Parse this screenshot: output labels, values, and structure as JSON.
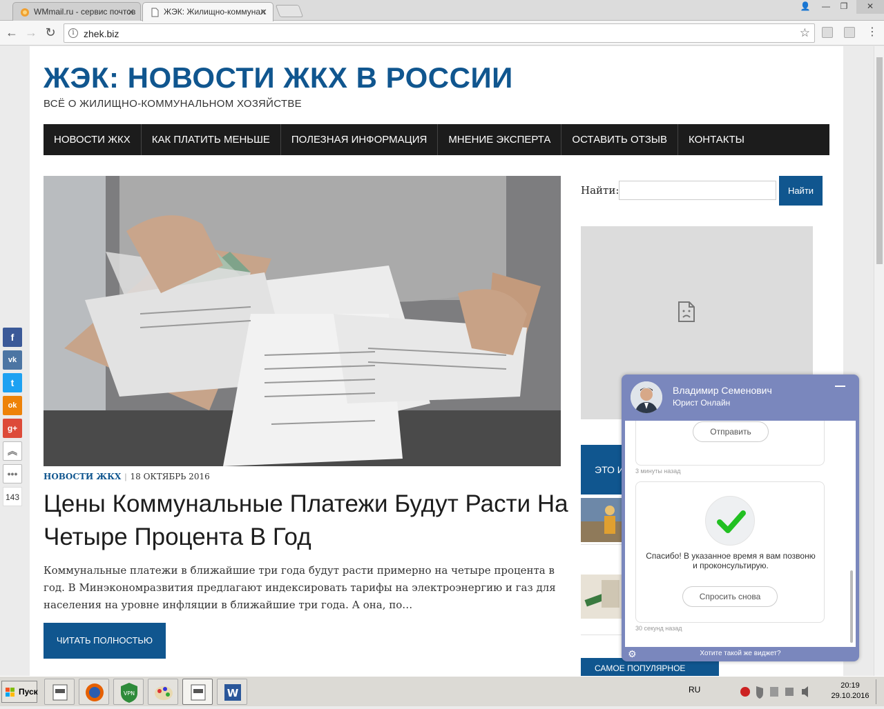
{
  "browser": {
    "tabs": [
      {
        "title": "WMmail.ru - сервис почтов",
        "active": false
      },
      {
        "title": "ЖЭК: Жилищно-коммунал",
        "active": true
      }
    ],
    "url": "zhek.biz"
  },
  "site": {
    "title": "ЖЭК: НОВОСТИ ЖКХ В РОССИИ",
    "description": "ВСЁ О ЖИЛИЩНО-КОММУНАЛЬНОМ ХОЗЯЙСТВЕ"
  },
  "menu": {
    "items": [
      "НОВОСТИ ЖКХ",
      "КАК ПЛАТИТЬ МЕНЬШЕ",
      "ПОЛЕЗНАЯ ИНФОРМАЦИЯ",
      "МНЕНИЕ ЭКСПЕРТА",
      "ОСТАВИТЬ ОТЗЫВ",
      "КОНТАКТЫ"
    ]
  },
  "post": {
    "category": "НОВОСТИ ЖКХ",
    "date": "18 ОКТЯБРЬ 2016",
    "title": "Цены Коммунальные Платежи Будут Расти На Четыре Процента В Год",
    "excerpt": "Коммунальные платежи в ближайшие три года будут расти примерно на четыре процента в год. В Минэкономразвития предлагают индексировать тарифы на электроэнергию и газ для населения на уровне инфляции в ближайшие три года. А она, по…",
    "read_more": "ЧИТАТЬ ПОЛНОСТЬЮ"
  },
  "sidebar": {
    "search_label": "Найти:",
    "search_button": "Найти",
    "banner_text": "ЭТО И",
    "banner2_text": "САМОЕ ПОПУЛЯРНОЕ"
  },
  "social": {
    "buttons": [
      {
        "icon": "facebook-icon",
        "glyph": "f",
        "color": "#3b5998"
      },
      {
        "icon": "vk-icon",
        "glyph": "vk",
        "color": "#4c75a3"
      },
      {
        "icon": "twitter-icon",
        "glyph": "t",
        "color": "#1da1f2"
      },
      {
        "icon": "odnoklassniki-icon",
        "glyph": "ok",
        "color": "#ee8208"
      },
      {
        "icon": "google-plus-icon",
        "glyph": "g+",
        "color": "#dd4b39"
      }
    ],
    "count": "143"
  },
  "chat": {
    "name": "Владимир Семенович",
    "role": "Юрист Онлайн",
    "send_button": "Отправить",
    "time1": "3 минуты назад",
    "thanks": "Спасибо! В указанное время я вам позвоню и проконсультирую.",
    "ask_again": "Спросить снова",
    "time2": "30 секунд назад",
    "footer_link": "Хотите такой же виджет?"
  },
  "taskbar": {
    "start": "Пуск",
    "lang": "RU",
    "time": "20:19",
    "date": "29.10.2016"
  },
  "colors": {
    "brand": "#10568f",
    "menu_bg": "#1c1c1c",
    "chat": "#7a87bd"
  }
}
